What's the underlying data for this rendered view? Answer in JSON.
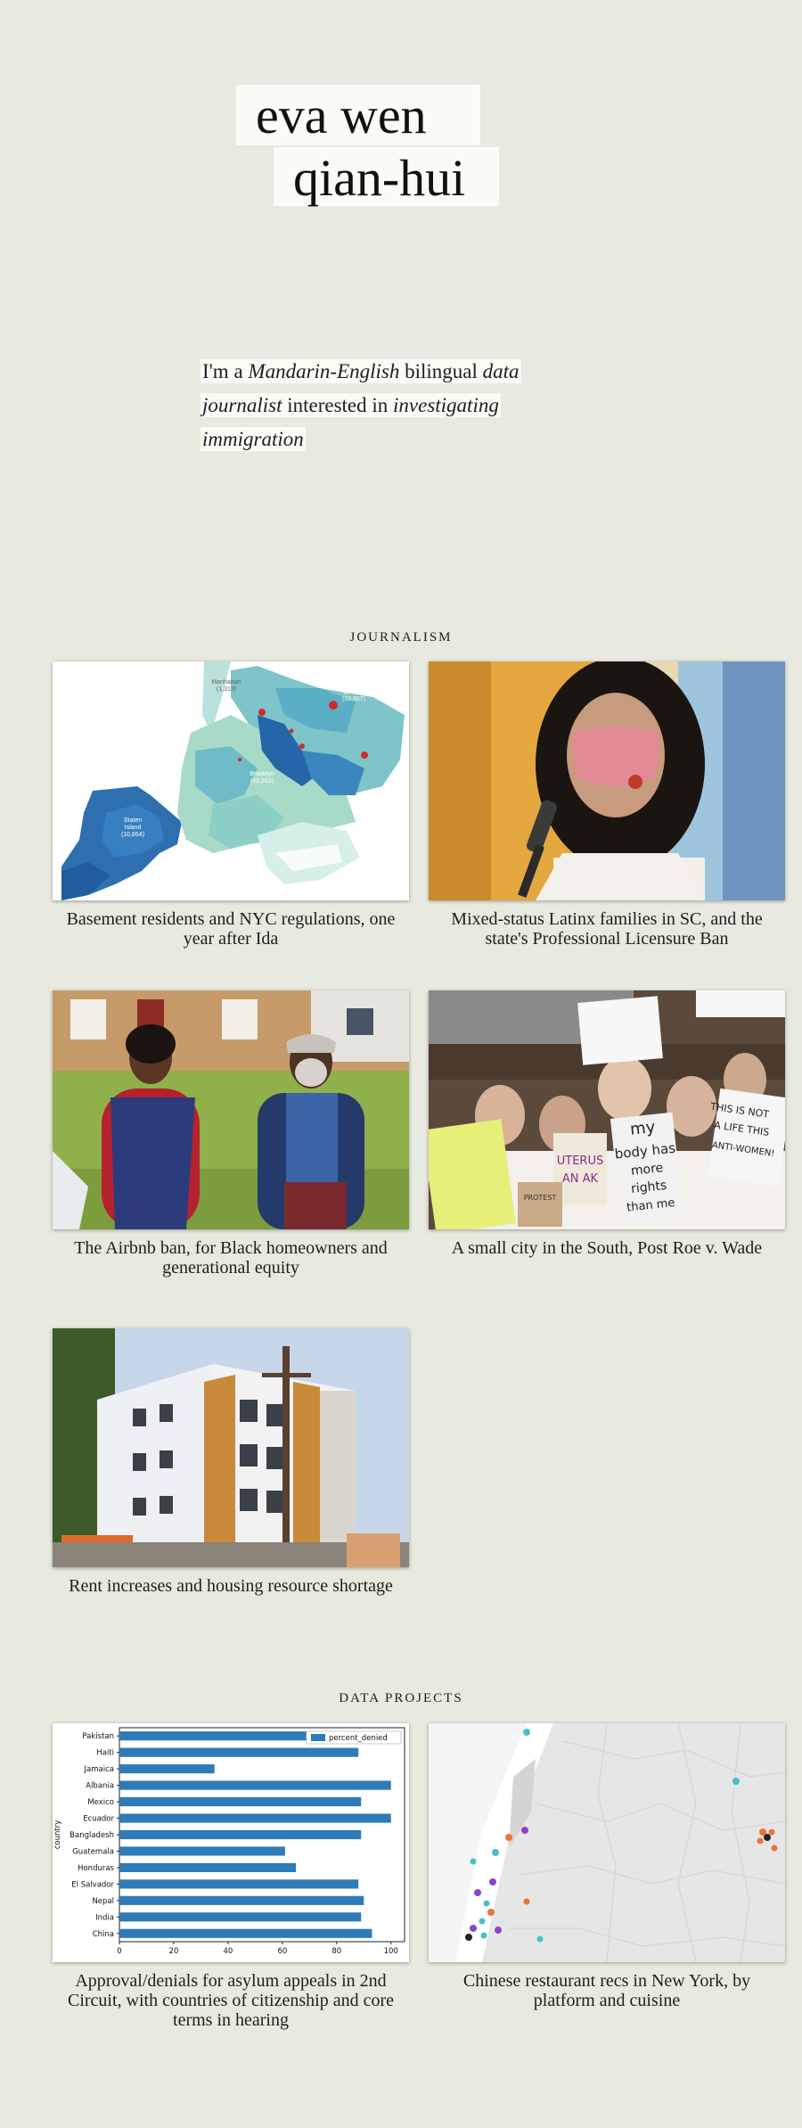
{
  "header": {
    "name_line1": "eva wen",
    "name_line2": "qian-hui"
  },
  "bio": {
    "p1": "I'm a ",
    "p2": "Mandarin-English",
    "p3": " bilingual ",
    "p4": "data journalist",
    "p5": " interested in ",
    "p6": "investigating immigration"
  },
  "journalism": {
    "title": "JOURNALISM",
    "items": [
      {
        "caption": "Basement residents and NYC regulations, one year after Ida"
      },
      {
        "caption": "Mixed-status Latinx families in SC, and the state's Professional Licensure Ban"
      },
      {
        "caption": "The Airbnb ban, for Black homeowners and generational equity"
      },
      {
        "caption": "A small city in the South, Post Roe v. Wade"
      },
      {
        "caption": "Rent increases and housing resource shortage"
      }
    ],
    "map_labels": {
      "manhattan": "Manhattan",
      "manhattan_n": "(1,313)",
      "queens": "Queens",
      "queens_n": "(33,807)",
      "brooklyn": "Brooklyn",
      "brooklyn_n": "(45,263)",
      "staten": "Staten",
      "island": "Island",
      "staten_n": "(10,654)"
    },
    "protest_signs": [
      "THIS IS NOT",
      "A LIFE THIS",
      "ANTI-WOMEN!",
      "my",
      "body has",
      "more",
      "rights",
      "than me",
      "UTERUS",
      "AN AK",
      "PROTEST"
    ]
  },
  "data_projects": {
    "title": "DATA PROJECTS",
    "items": [
      {
        "caption": "Approval/denials for asylum appeals in 2nd Circuit, with countries of citizenship and core terms in hearing"
      },
      {
        "caption": "Chinese restaurant recs in New York, by platform and cuisine"
      }
    ]
  },
  "chart_data": {
    "type": "bar",
    "orientation": "horizontal",
    "categories": [
      "Pakistan",
      "Haiti",
      "Jamaica",
      "Albania",
      "Mexico",
      "Ecuador",
      "Bangladesh",
      "Guatemala",
      "Honduras",
      "El Salvador",
      "Nepal",
      "India",
      "China"
    ],
    "series": [
      {
        "name": "percent_denied",
        "values": [
          70,
          88,
          35,
          100,
          89,
          100,
          89,
          61,
          65,
          88,
          90,
          89,
          93
        ]
      }
    ],
    "ylabel": "country",
    "xlim": [
      0,
      105
    ],
    "xticks": [
      0,
      20,
      40,
      60,
      80,
      100
    ],
    "legend": "top-right",
    "color": "#2f7ab8"
  }
}
